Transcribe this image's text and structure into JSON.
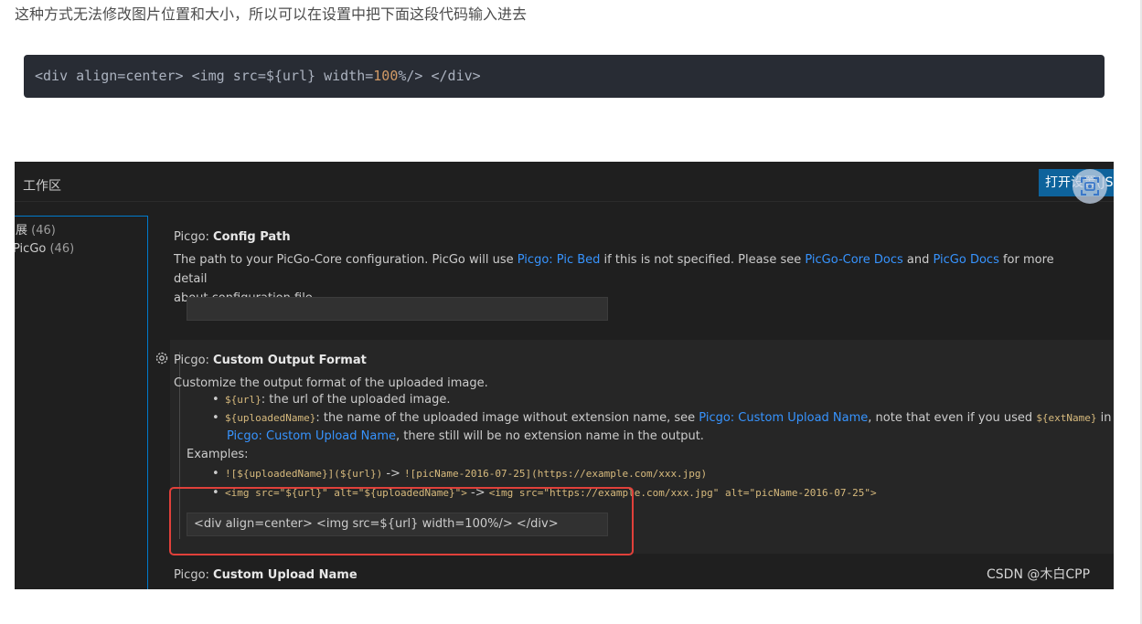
{
  "article": {
    "intro_text": "这种方式无法修改图片位置和大小，所以可以在设置中把下面这段代码输入进去",
    "code_before_num": "<div align=center> <img src=${url} width=",
    "code_num": "100",
    "code_after_num": "%/> </div>"
  },
  "vscode": {
    "workspace_tab": "工作区",
    "open_button": "打开设置(JSON)",
    "sidebar": [
      {
        "label": "展",
        "count": "(46)"
      },
      {
        "label": "PicGo",
        "count": "(46)"
      }
    ],
    "config_path": {
      "prefix": "Picgo: ",
      "title": "Config Path",
      "desc_1": "The path to your PicGo-Core configuration. PicGo will use ",
      "link_1": "Picgo: Pic Bed",
      "desc_2": " if this is not specified. Please see ",
      "link_2": "PicGo-Core Docs",
      "desc_3": " and ",
      "link_3": "PicGo Docs",
      "desc_4": " for more detail",
      "desc_5": "about configuration file.",
      "value": ""
    },
    "custom_output": {
      "prefix": "Picgo: ",
      "title": "Custom Output Format",
      "desc": "Customize the output format of the uploaded image.",
      "b1_code": "${url}",
      "b1_text": ": the url of the uploaded image.",
      "b2_code": "${uploadedName}",
      "b2_text_1": ": the name of the uploaded image without extension name, see ",
      "b2_link_1": "Picgo: Custom Upload Name",
      "b2_text_2": ", note that even if you used ",
      "b2_code_2": "${extName}",
      "b2_text_3": " in",
      "b2_link_2": "Picgo: Custom Upload Name",
      "b2_text_4": ", there still will be no extension name in the output.",
      "examples_label": "Examples:",
      "ex1_code_a": "![${uploadedName}](${url})",
      "ex1_arrow": " -> ",
      "ex1_code_b": "![picName-2016-07-25](https://example.com/xxx.jpg)",
      "ex2_code_a": "<img src=\"${url}\" alt=\"${uploadedName}\">",
      "ex2_arrow": " -> ",
      "ex2_code_b": "<img src=\"https://example.com/xxx.jpg\" alt=\"picName-2016-07-25\">",
      "value": "<div align=center> <img src=${url} width=100%/> </div>"
    },
    "custom_upload": {
      "prefix": "Picgo: ",
      "title": "Custom Upload Name"
    },
    "watermark": "CSDN @木白CPP"
  },
  "colors": {
    "accent": "#0e639c",
    "link": "#3794ff",
    "highlight_box": "#e0403a",
    "code_bg": "#282c34"
  }
}
